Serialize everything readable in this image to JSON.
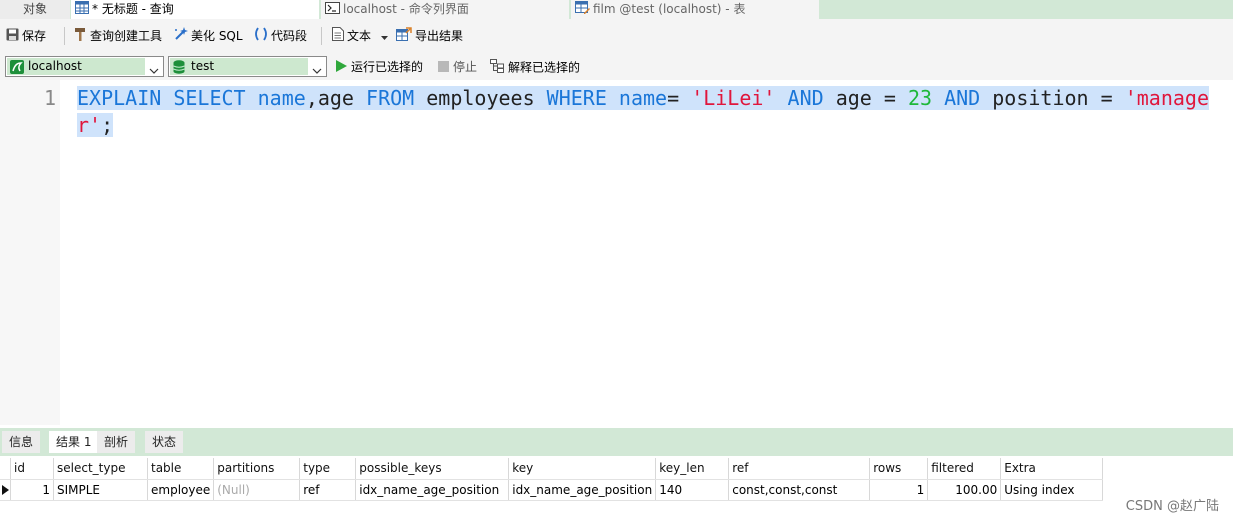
{
  "tabs": [
    {
      "label": "对象"
    },
    {
      "label": "* 无标题 - 查询"
    },
    {
      "label": "localhost - 命令列界面"
    },
    {
      "label": "film @test (localhost) - 表"
    }
  ],
  "toolbar": {
    "save": "保存",
    "query_builder": "查询创建工具",
    "beautify": "美化 SQL",
    "code_snippet": "代码段",
    "text": "文本",
    "export": "导出结果"
  },
  "selectors": {
    "connection": "localhost",
    "database": "test",
    "run_selected": "运行已选择的",
    "stop": "停止",
    "explain_selected": "解释已选择的"
  },
  "editor": {
    "line_number": "1",
    "tokens": {
      "t1": "EXPLAIN",
      "t2": " ",
      "t3": "SELECT",
      "t4": " ",
      "t5": "name",
      "t6": ",age ",
      "t7": "FROM",
      "t8": " employees ",
      "t9": "WHERE",
      "t10": " ",
      "t11": "name",
      "t12": "= ",
      "t13": "'LiLei'",
      "t14": " ",
      "t15": "AND",
      "t16": " age = ",
      "t17": "23",
      "t18": " ",
      "t19": "AND",
      "t20": " position = ",
      "t21": "'manager'",
      "t22": ";"
    }
  },
  "result_tabs": [
    {
      "label": "信息"
    },
    {
      "label": "结果 1"
    },
    {
      "label": "剖析"
    },
    {
      "label": "状态"
    }
  ],
  "result": {
    "columns": [
      "id",
      "select_type",
      "table",
      "partitions",
      "type",
      "possible_keys",
      "key",
      "key_len",
      "ref",
      "rows",
      "filtered",
      "Extra"
    ],
    "row": [
      "1",
      "SIMPLE",
      "employee",
      "(Null)",
      "ref",
      "idx_name_age_position",
      "idx_name_age_position",
      "140",
      "const,const,const",
      "1",
      "100.00",
      "Using index"
    ]
  },
  "watermark": "CSDN @赵广陆",
  "colors": {
    "tab_bar": "#d2e8d6",
    "keyword": "#1a76d8",
    "string": "#e0163c",
    "number": "#1fb83a",
    "selection": "#cfe3fb"
  }
}
